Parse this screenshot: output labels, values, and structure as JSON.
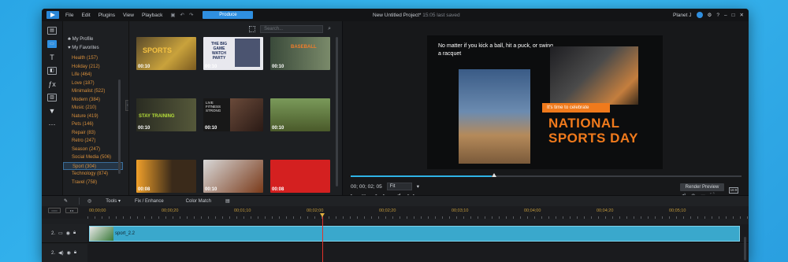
{
  "titlebar": {
    "menu": [
      "File",
      "Edit",
      "Plugins",
      "View",
      "Playback"
    ],
    "produce_label": "Produce",
    "project_title": "New Untitled Project*",
    "saved_status": "15:05 last saved",
    "user_name": "Planet J"
  },
  "library": {
    "search_placeholder": "Search...",
    "top_items": [
      "My Profile",
      "My Favorites"
    ],
    "categories": [
      {
        "label": "Health  (157)"
      },
      {
        "label": "Holiday  (212)"
      },
      {
        "label": "Life  (464)"
      },
      {
        "label": "Love  (187)"
      },
      {
        "label": "Minimalist  (522)"
      },
      {
        "label": "Modern  (384)"
      },
      {
        "label": "Music  (210)"
      },
      {
        "label": "Nature  (419)"
      },
      {
        "label": "Pets  (146)"
      },
      {
        "label": "Repair  (83)"
      },
      {
        "label": "Retro  (247)"
      },
      {
        "label": "Season  (247)"
      },
      {
        "label": "Social Media  (506)"
      },
      {
        "label": "Sport  (304)"
      },
      {
        "label": "Technology  (874)"
      },
      {
        "label": "Travel  (758)"
      }
    ],
    "selected_category": "Sport  (304)",
    "tiles": [
      {
        "label": "SPORTS",
        "duration": "00:10"
      },
      {
        "label": "THE BIG GAME WATCH PARTY",
        "duration": "00:10"
      },
      {
        "label": "BASEBALL",
        "duration": "00:10"
      },
      {
        "label": "STAY TRAINING",
        "duration": "00:10"
      },
      {
        "label": "LIVE FITNESS STRONG",
        "duration": "00:10"
      },
      {
        "label": "",
        "duration": "00:10"
      },
      {
        "label": "",
        "duration": "00:08"
      },
      {
        "label": "",
        "duration": "00:10"
      },
      {
        "label": "",
        "duration": "00:08"
      }
    ]
  },
  "preview": {
    "caption": "No matter if you kick a ball, hit a puck, or swing a racquet",
    "banner": "It's time to celebrate",
    "headline_1": "NATIONAL",
    "headline_2": "SPORTS DAY",
    "timecode": "00; 00; 02; 05",
    "fit_label": "Fit",
    "render_label": "Render Preview",
    "aspect_label": "16:9",
    "progress": 0.36
  },
  "timeline": {
    "tools_label": "Tools",
    "fix_label": "Fix / Enhance",
    "color_label": "Color Match",
    "ruler_marks": [
      "00;00;00",
      "00;00;20",
      "00;01;10",
      "00;02;00",
      "00;02;20",
      "00;03;10",
      "00;04;00",
      "00;04;20",
      "00;05;10"
    ],
    "track1_label": "2.",
    "track2_label": "2.",
    "clip_name": "sport_2.2"
  }
}
